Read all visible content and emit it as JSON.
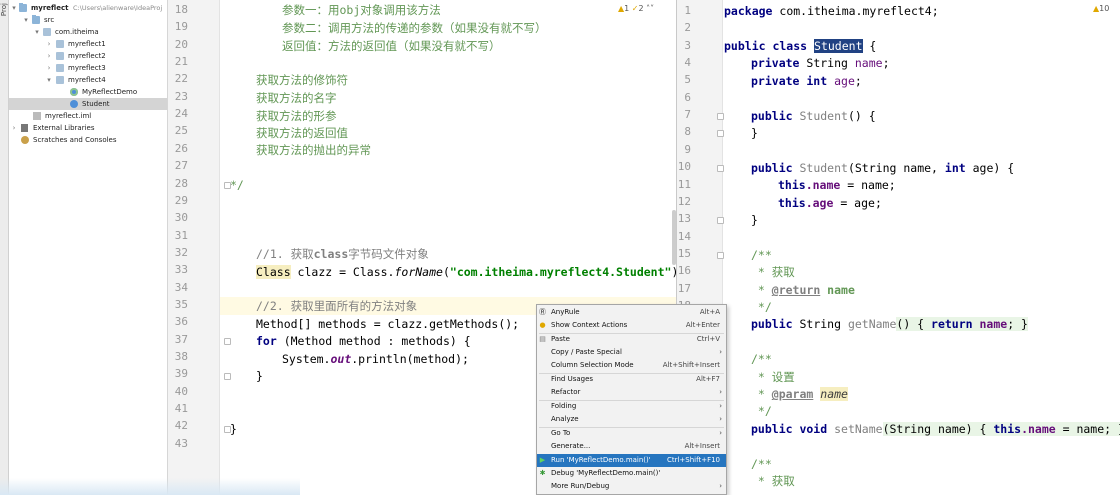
{
  "side_strip": {
    "label": "Proj"
  },
  "tree": {
    "root": {
      "name": "myreflect",
      "path": "C:\\Users\\alienware\\IdeaProj"
    },
    "src": "src",
    "pkg": "com.itheima",
    "subpkgs": [
      "myreflect1",
      "myreflect2",
      "myreflect3",
      "myreflect4"
    ],
    "files": [
      "MyReflectDemo",
      "Student"
    ],
    "iml": "myreflect.iml",
    "ext_libs": "External Libraries",
    "scratches": "Scratches and Consoles"
  },
  "left_editor": {
    "warnings": {
      "w1": "1",
      "w2": "2"
    },
    "lines": [
      "18",
      "19",
      "20",
      "21",
      "22",
      "23",
      "24",
      "25",
      "26",
      "27",
      "28",
      "29",
      "30",
      "31",
      "32",
      "33",
      "34",
      "35",
      "36",
      "37",
      "38",
      "39",
      "40",
      "41",
      "42",
      "43"
    ],
    "c18": "参数一：用obj对象调用该方法",
    "c19": "参数二：调用方法的传递的参数（如果没有就不写）",
    "c20": "返回值：方法的返回值（如果没有就不写）",
    "c22": "获取方法的修饰符",
    "c23": "获取方法的名字",
    "c24": "获取方法的形参",
    "c25": "获取方法的返回值",
    "c26": "获取方法的抛出的异常",
    "c28": "*/",
    "c32_a": "//1. 获取",
    "c32_b": "class",
    "c32_c": "字节码文件对象",
    "c33_cls": "Class",
    "c33_a": " clazz = Class.",
    "c33_m": "forName",
    "c33_b": "(",
    "c33_s": "\"com.itheima.myreflect4.Student\"",
    "c33_c": ");",
    "c35": "//2. 获取里面所有的方法对象",
    "c36": "Method[] methods = clazz.getMethods();",
    "c37_kw": "for",
    "c37": " (Method method : methods) {",
    "c38_a": "System.",
    "c38_out": "out",
    "c38_b": ".println(method);",
    "c39": "}",
    "c42": "}"
  },
  "right_editor": {
    "warn": "10",
    "lines": [
      "1",
      "2",
      "3",
      "4",
      "5",
      "6",
      "7",
      "8",
      "9",
      "10",
      "11",
      "12",
      "13",
      "14",
      "15",
      "16",
      "17",
      "18",
      "19",
      "20",
      "21",
      "22",
      "23",
      "24",
      "25",
      "26",
      "27",
      "28"
    ],
    "r1_kw": "package",
    "r1": " com.itheima.myreflect4;",
    "r3_kw": "public class",
    "r3_name": "Student",
    "r3_b": " {",
    "r4_kw": "private",
    "r4_t": " String ",
    "r4_f": "name",
    "r4_e": ";",
    "r5_kw": "private int",
    "r5_f": "age",
    "r5_e": ";",
    "r7_kw": "public",
    "r7_m": "Student",
    "r7_e": "() {",
    "r8": "}",
    "r10_kw": "public",
    "r10_m": "Student",
    "r10_a": "(String name, ",
    "r10_int": "int",
    "r10_b": " age) {",
    "r11_this": "this",
    "r11_f": ".name",
    "r11_e": " = name;",
    "r12_this": "this",
    "r12_f": ".age",
    "r12_e": " = age;",
    "r13": "}",
    "r15": "/**",
    "r16": " * 获取",
    "r17_a": " * ",
    "r17_tag": "@return",
    "r17_b": " name",
    "r18": " */",
    "r19_kw": "public",
    "r19_t": " String ",
    "r19_m": "getName",
    "r19_a": "() { ",
    "r19_ret": "return",
    "r19_f": " name",
    "r19_e": "; }",
    "r21": "/**",
    "r22": " * 设置",
    "r23_a": " * ",
    "r23_tag": "@param",
    "r23_p": "name",
    "r24": " */",
    "r25_kw": "public void",
    "r25_m": "setName",
    "r25_a": "(String name) { ",
    "r25_this": "this",
    "r25_f": ".name",
    "r25_e": " = name; }",
    "r27": "/**",
    "r28": " * 获取"
  },
  "context_menu": {
    "items": [
      {
        "icon": "AnyRule-icon",
        "label": "AnyRule",
        "shortcut": "Alt+A"
      },
      {
        "icon": "bulb-icon",
        "label": "Show Context Actions",
        "shortcut": "Alt+Enter"
      },
      {
        "icon": "paste-icon",
        "label": "Paste",
        "shortcut": "Ctrl+V"
      },
      {
        "icon": "",
        "label": "Copy / Paste Special",
        "shortcut": ""
      },
      {
        "icon": "",
        "label": "Column Selection Mode",
        "shortcut": "Alt+Shift+Insert"
      },
      {
        "icon": "",
        "label": "Find Usages",
        "shortcut": "Alt+F7"
      },
      {
        "icon": "",
        "label": "Refactor",
        "shortcut": ""
      },
      {
        "icon": "",
        "label": "Folding",
        "shortcut": ""
      },
      {
        "icon": "",
        "label": "Analyze",
        "shortcut": ""
      },
      {
        "icon": "",
        "label": "Go To",
        "shortcut": ""
      },
      {
        "icon": "",
        "label": "Generate...",
        "shortcut": "Alt+Insert"
      },
      {
        "icon": "run-icon",
        "label": "Run 'MyReflectDemo.main()'",
        "shortcut": "Ctrl+Shift+F10"
      },
      {
        "icon": "debug-icon",
        "label": "Debug 'MyReflectDemo.main()'",
        "shortcut": ""
      },
      {
        "icon": "",
        "label": "More Run/Debug",
        "shortcut": ""
      }
    ],
    "active_index": 11,
    "accent": "#2675bf"
  }
}
